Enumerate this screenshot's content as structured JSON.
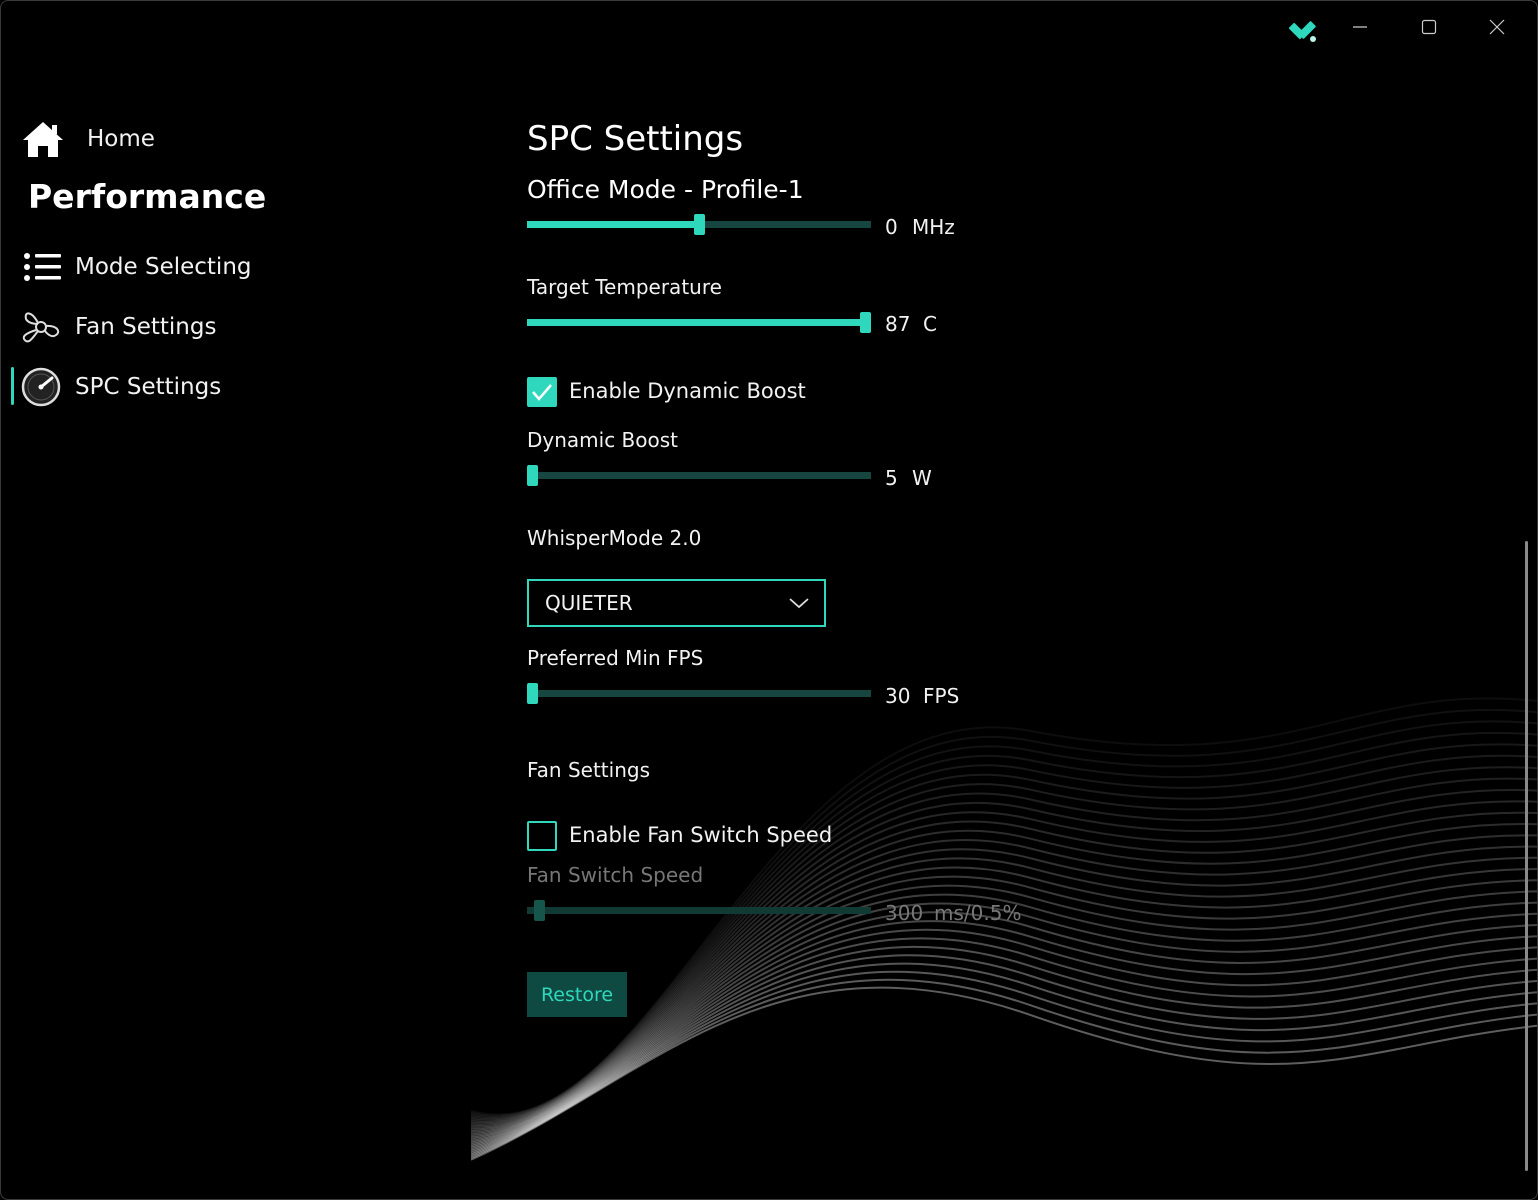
{
  "window": {
    "app_icon": "wrench-screwdriver-icon",
    "controls": {
      "minimize": "minimize-icon",
      "maximize": "maximize-icon",
      "close": "close-icon"
    }
  },
  "sidebar": {
    "home": {
      "label": "Home",
      "icon": "home-icon"
    },
    "section_title": "Performance",
    "items": [
      {
        "label": "Mode Selecting",
        "icon": "list-icon"
      },
      {
        "label": "Fan Settings",
        "icon": "fan-icon"
      },
      {
        "label": "SPC Settings",
        "icon": "gauge-icon",
        "selected": true
      }
    ]
  },
  "main": {
    "title": "SPC Settings",
    "profile_title": "Office Mode - Profile-1",
    "clock_offset": {
      "value": "0",
      "unit": "MHz",
      "fraction": 0.5
    },
    "target_temperature": {
      "label": "Target Temperature",
      "value": "87",
      "unit": "C",
      "fraction": 1.0
    },
    "enable_dynamic_boost": {
      "label": "Enable Dynamic Boost",
      "checked": true
    },
    "dynamic_boost": {
      "label": "Dynamic Boost",
      "value": "5",
      "unit": "W",
      "fraction": 0.0
    },
    "whisper_mode": {
      "label": "WhisperMode 2.0",
      "selected": "QUIETER"
    },
    "preferred_min_fps": {
      "label": "Preferred Min FPS",
      "value": "30",
      "unit": "FPS",
      "fraction": 0.0
    },
    "fan_settings": {
      "label": "Fan Settings"
    },
    "enable_fan_switch_speed": {
      "label": "Enable Fan Switch Speed",
      "checked": false
    },
    "fan_switch_speed": {
      "label": "Fan Switch Speed",
      "value": "300",
      "unit": "ms/0.5%",
      "fraction": 0.02,
      "disabled": true
    },
    "restore_label": "Restore"
  },
  "colors": {
    "accent": "#2fd8bd",
    "background": "#000000",
    "accent_dim": "#16463f"
  }
}
